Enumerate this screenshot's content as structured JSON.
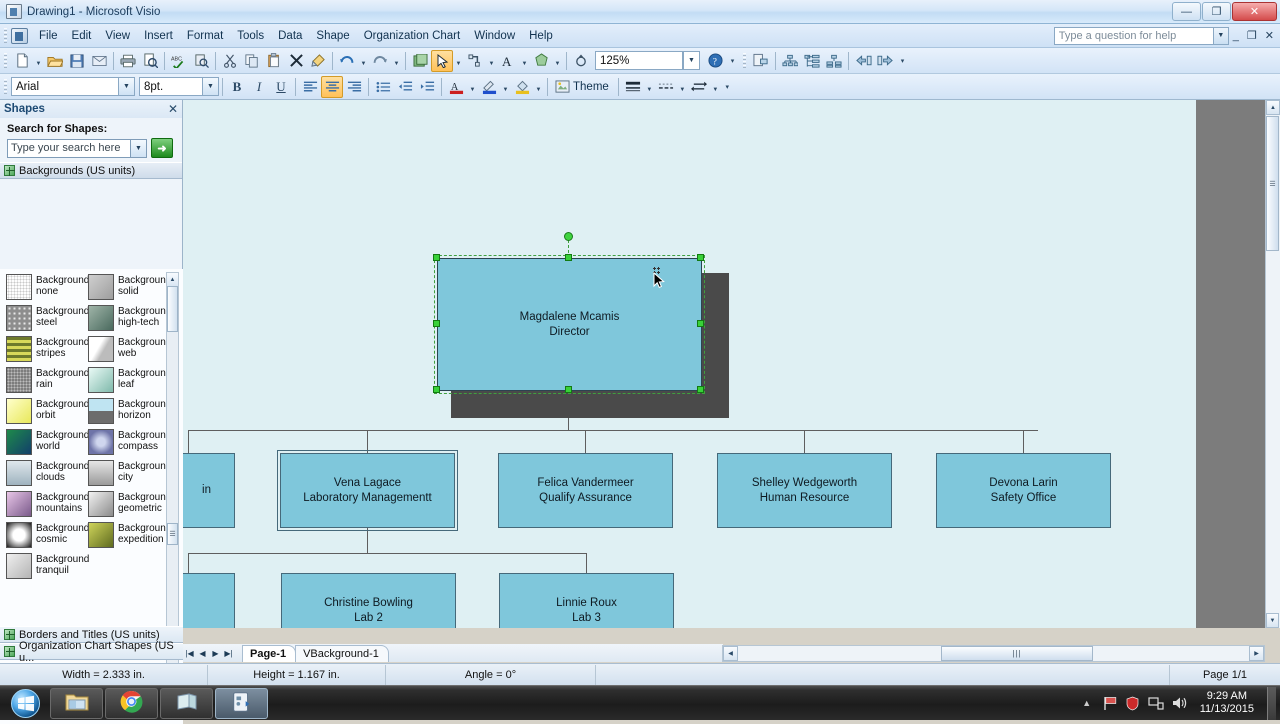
{
  "window": {
    "title": "Drawing1 - Microsoft Visio",
    "app_icon": "visio-icon",
    "minimize": "—",
    "restore": "❐",
    "close": "✕"
  },
  "menu": {
    "items": [
      {
        "label": "File"
      },
      {
        "label": "Edit"
      },
      {
        "label": "View"
      },
      {
        "label": "Insert"
      },
      {
        "label": "Format"
      },
      {
        "label": "Tools"
      },
      {
        "label": "Data"
      },
      {
        "label": "Shape"
      },
      {
        "label": "Organization Chart"
      },
      {
        "label": "Window"
      },
      {
        "label": "Help"
      }
    ],
    "ask_help_placeholder": "Type a question for help",
    "win_minimize": "_",
    "win_restore": "❐",
    "win_close": "✕"
  },
  "standard_toolbar": {
    "buttons": [
      {
        "name": "new-document-button",
        "glyph": "📄"
      },
      {
        "name": "open-button",
        "glyph": "📂"
      },
      {
        "name": "save-button",
        "glyph": "💾"
      },
      {
        "name": "email-button",
        "glyph": "✉"
      },
      {
        "name": "print-button",
        "glyph": "🖨"
      },
      {
        "name": "print-preview-button",
        "glyph": "🔍"
      },
      {
        "name": "spelling-button",
        "glyph": "ABC"
      },
      {
        "name": "research-button",
        "glyph": "📑"
      },
      {
        "name": "cut-button",
        "glyph": "✂"
      },
      {
        "name": "copy-button",
        "glyph": "⧉"
      },
      {
        "name": "paste-button",
        "glyph": "📋"
      },
      {
        "name": "delete-button",
        "glyph": "✕"
      },
      {
        "name": "format-painter-button",
        "glyph": "🖌"
      },
      {
        "name": "undo-button",
        "glyph": "↶"
      },
      {
        "name": "redo-button",
        "glyph": "↷"
      },
      {
        "name": "insert-object-button",
        "glyph": "▦"
      },
      {
        "name": "pointer-tool-button",
        "glyph": "➤"
      },
      {
        "name": "connector-tool-button",
        "glyph": "⌐"
      },
      {
        "name": "text-tool-button",
        "glyph": "A"
      },
      {
        "name": "autoshape-button",
        "glyph": "⬠"
      },
      {
        "name": "rotate-button",
        "glyph": "⟳"
      }
    ],
    "zoom_value": "125%",
    "help_button": "?",
    "org_buttons": [
      {
        "name": "org-insert-button",
        "glyph": "▤"
      },
      {
        "name": "org-horizontal-layout-button",
        "glyph": "⫳"
      },
      {
        "name": "org-vertical-layout-button",
        "glyph": "⫴"
      },
      {
        "name": "org-side-by-side-button",
        "glyph": "⊞"
      },
      {
        "name": "org-move-left-button",
        "glyph": "⇦"
      },
      {
        "name": "org-move-right-button",
        "glyph": "⇨"
      }
    ]
  },
  "format_toolbar": {
    "font_name": "Arial",
    "font_size": "8pt.",
    "bold": "B",
    "italic": "I",
    "underline": "U",
    "align_left": "≡",
    "align_center": "≡",
    "align_right": "≡",
    "bullets": "≔",
    "increase_indent": "⇥",
    "decrease_indent": "⇤",
    "font_color": "A",
    "line_color": "✎",
    "fill_color": "◔",
    "theme_label": "Theme",
    "line_weight": "▬",
    "line_pattern": "┄",
    "line_ends": "↔"
  },
  "shapes_pane": {
    "title": "Shapes",
    "close": "✕",
    "search_label": "Search for Shapes:",
    "search_placeholder": "Type your search here",
    "search_go": "➜",
    "stencil_title": "Backgrounds (US units)",
    "shapes": [
      {
        "label1": "Background",
        "label2": "none",
        "swatch": "none"
      },
      {
        "label1": "Background",
        "label2": "solid",
        "swatch": "solid"
      },
      {
        "label1": "Background",
        "label2": "steel",
        "swatch": "steel"
      },
      {
        "label1": "Background",
        "label2": "high-tech",
        "swatch": "hightech"
      },
      {
        "label1": "Background",
        "label2": "stripes",
        "swatch": "stripes"
      },
      {
        "label1": "Background",
        "label2": "web",
        "swatch": "web"
      },
      {
        "label1": "Background",
        "label2": "rain",
        "swatch": "rain"
      },
      {
        "label1": "Background",
        "label2": "leaf",
        "swatch": "leaf"
      },
      {
        "label1": "Background",
        "label2": "orbit",
        "swatch": "orbit"
      },
      {
        "label1": "Background",
        "label2": "horizon",
        "swatch": "horizon"
      },
      {
        "label1": "Background",
        "label2": "world",
        "swatch": "world"
      },
      {
        "label1": "Background",
        "label2": "compass",
        "swatch": "compass"
      },
      {
        "label1": "Background",
        "label2": "clouds",
        "swatch": "clouds"
      },
      {
        "label1": "Background",
        "label2": "city",
        "swatch": "city"
      },
      {
        "label1": "Background",
        "label2": "mountains",
        "swatch": "mountains"
      },
      {
        "label1": "Background",
        "label2": "geometric",
        "swatch": "geometric"
      },
      {
        "label1": "Background",
        "label2": "cosmic",
        "swatch": "cosmic"
      },
      {
        "label1": "Background",
        "label2": "expedition",
        "swatch": "expedition"
      },
      {
        "label1": "Background",
        "label2": "tranquil",
        "swatch": "tranquil"
      }
    ],
    "other_stencils": [
      {
        "label": "Borders and Titles (US units)"
      },
      {
        "label": "Organization Chart Shapes (US u..."
      }
    ]
  },
  "diagram": {
    "selected_node": {
      "name": "Magdalene Mcamis",
      "title": "Director"
    },
    "nodes": [
      {
        "name": "",
        "title": "in",
        "partial": true
      },
      {
        "name": "Vena Lagace",
        "title": "Laboratory Managementt",
        "subselected": true
      },
      {
        "name": "Felica Vandermeer",
        "title": "Qualify Assurance"
      },
      {
        "name": "Shelley Wedgeworth",
        "title": "Human Resource"
      },
      {
        "name": "Devona Larin",
        "title": "Safety Office"
      },
      {
        "name": "",
        "title": "",
        "partial": true
      },
      {
        "name": "Christine Bowling",
        "title": "Lab 2"
      },
      {
        "name": "Linnie Roux",
        "title": "Lab 3"
      }
    ],
    "fill_color": "#7fc7db",
    "border_color": "#45697a",
    "page_color": "#dff0f3",
    "handle_color": "#39d139"
  },
  "page_tabs": {
    "nav_first": "|◀",
    "nav_prev": "◀",
    "nav_next": "▶",
    "nav_last": "▶|",
    "tabs": [
      {
        "label": "Page-1",
        "active": true
      },
      {
        "label": "VBackground-1",
        "active": false
      }
    ]
  },
  "status_bar": {
    "width": "Width = 2.333 in.",
    "height": "Height = 1.167 in.",
    "angle": "Angle = 0°",
    "page": "Page 1/1"
  },
  "taskbar": {
    "start": "start-orb",
    "items": [
      {
        "name": "taskbar-explorer",
        "icon": "folder-icon",
        "active": false
      },
      {
        "name": "taskbar-chrome",
        "icon": "chrome-icon",
        "active": false
      },
      {
        "name": "taskbar-notepad",
        "icon": "notepad-icon",
        "active": false
      },
      {
        "name": "taskbar-visio",
        "icon": "visio-icon",
        "active": true
      }
    ],
    "tray": [
      {
        "name": "show-hidden-icons",
        "glyph": "▲"
      },
      {
        "name": "flag-icon",
        "glyph": "⚑"
      },
      {
        "name": "security-icon",
        "glyph": "🛡"
      },
      {
        "name": "network-icon",
        "glyph": "🖧"
      },
      {
        "name": "volume-icon",
        "glyph": "🔊"
      }
    ],
    "time": "9:29 AM",
    "date": "11/13/2015"
  }
}
